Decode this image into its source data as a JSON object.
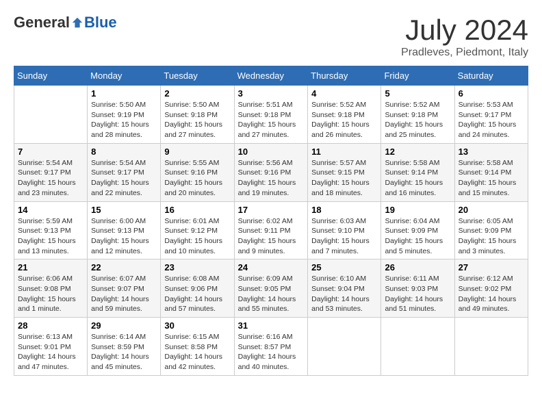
{
  "header": {
    "logo_general": "General",
    "logo_blue": "Blue",
    "month_title": "July 2024",
    "location": "Pradleves, Piedmont, Italy"
  },
  "weekdays": [
    "Sunday",
    "Monday",
    "Tuesday",
    "Wednesday",
    "Thursday",
    "Friday",
    "Saturday"
  ],
  "weeks": [
    [
      {
        "day": "",
        "sunrise": "",
        "sunset": "",
        "daylight": ""
      },
      {
        "day": "1",
        "sunrise": "Sunrise: 5:50 AM",
        "sunset": "Sunset: 9:19 PM",
        "daylight": "Daylight: 15 hours and 28 minutes."
      },
      {
        "day": "2",
        "sunrise": "Sunrise: 5:50 AM",
        "sunset": "Sunset: 9:18 PM",
        "daylight": "Daylight: 15 hours and 27 minutes."
      },
      {
        "day": "3",
        "sunrise": "Sunrise: 5:51 AM",
        "sunset": "Sunset: 9:18 PM",
        "daylight": "Daylight: 15 hours and 27 minutes."
      },
      {
        "day": "4",
        "sunrise": "Sunrise: 5:52 AM",
        "sunset": "Sunset: 9:18 PM",
        "daylight": "Daylight: 15 hours and 26 minutes."
      },
      {
        "day": "5",
        "sunrise": "Sunrise: 5:52 AM",
        "sunset": "Sunset: 9:18 PM",
        "daylight": "Daylight: 15 hours and 25 minutes."
      },
      {
        "day": "6",
        "sunrise": "Sunrise: 5:53 AM",
        "sunset": "Sunset: 9:17 PM",
        "daylight": "Daylight: 15 hours and 24 minutes."
      }
    ],
    [
      {
        "day": "7",
        "sunrise": "Sunrise: 5:54 AM",
        "sunset": "Sunset: 9:17 PM",
        "daylight": "Daylight: 15 hours and 23 minutes."
      },
      {
        "day": "8",
        "sunrise": "Sunrise: 5:54 AM",
        "sunset": "Sunset: 9:17 PM",
        "daylight": "Daylight: 15 hours and 22 minutes."
      },
      {
        "day": "9",
        "sunrise": "Sunrise: 5:55 AM",
        "sunset": "Sunset: 9:16 PM",
        "daylight": "Daylight: 15 hours and 20 minutes."
      },
      {
        "day": "10",
        "sunrise": "Sunrise: 5:56 AM",
        "sunset": "Sunset: 9:16 PM",
        "daylight": "Daylight: 15 hours and 19 minutes."
      },
      {
        "day": "11",
        "sunrise": "Sunrise: 5:57 AM",
        "sunset": "Sunset: 9:15 PM",
        "daylight": "Daylight: 15 hours and 18 minutes."
      },
      {
        "day": "12",
        "sunrise": "Sunrise: 5:58 AM",
        "sunset": "Sunset: 9:14 PM",
        "daylight": "Daylight: 15 hours and 16 minutes."
      },
      {
        "day": "13",
        "sunrise": "Sunrise: 5:58 AM",
        "sunset": "Sunset: 9:14 PM",
        "daylight": "Daylight: 15 hours and 15 minutes."
      }
    ],
    [
      {
        "day": "14",
        "sunrise": "Sunrise: 5:59 AM",
        "sunset": "Sunset: 9:13 PM",
        "daylight": "Daylight: 15 hours and 13 minutes."
      },
      {
        "day": "15",
        "sunrise": "Sunrise: 6:00 AM",
        "sunset": "Sunset: 9:13 PM",
        "daylight": "Daylight: 15 hours and 12 minutes."
      },
      {
        "day": "16",
        "sunrise": "Sunrise: 6:01 AM",
        "sunset": "Sunset: 9:12 PM",
        "daylight": "Daylight: 15 hours and 10 minutes."
      },
      {
        "day": "17",
        "sunrise": "Sunrise: 6:02 AM",
        "sunset": "Sunset: 9:11 PM",
        "daylight": "Daylight: 15 hours and 9 minutes."
      },
      {
        "day": "18",
        "sunrise": "Sunrise: 6:03 AM",
        "sunset": "Sunset: 9:10 PM",
        "daylight": "Daylight: 15 hours and 7 minutes."
      },
      {
        "day": "19",
        "sunrise": "Sunrise: 6:04 AM",
        "sunset": "Sunset: 9:09 PM",
        "daylight": "Daylight: 15 hours and 5 minutes."
      },
      {
        "day": "20",
        "sunrise": "Sunrise: 6:05 AM",
        "sunset": "Sunset: 9:09 PM",
        "daylight": "Daylight: 15 hours and 3 minutes."
      }
    ],
    [
      {
        "day": "21",
        "sunrise": "Sunrise: 6:06 AM",
        "sunset": "Sunset: 9:08 PM",
        "daylight": "Daylight: 15 hours and 1 minute."
      },
      {
        "day": "22",
        "sunrise": "Sunrise: 6:07 AM",
        "sunset": "Sunset: 9:07 PM",
        "daylight": "Daylight: 14 hours and 59 minutes."
      },
      {
        "day": "23",
        "sunrise": "Sunrise: 6:08 AM",
        "sunset": "Sunset: 9:06 PM",
        "daylight": "Daylight: 14 hours and 57 minutes."
      },
      {
        "day": "24",
        "sunrise": "Sunrise: 6:09 AM",
        "sunset": "Sunset: 9:05 PM",
        "daylight": "Daylight: 14 hours and 55 minutes."
      },
      {
        "day": "25",
        "sunrise": "Sunrise: 6:10 AM",
        "sunset": "Sunset: 9:04 PM",
        "daylight": "Daylight: 14 hours and 53 minutes."
      },
      {
        "day": "26",
        "sunrise": "Sunrise: 6:11 AM",
        "sunset": "Sunset: 9:03 PM",
        "daylight": "Daylight: 14 hours and 51 minutes."
      },
      {
        "day": "27",
        "sunrise": "Sunrise: 6:12 AM",
        "sunset": "Sunset: 9:02 PM",
        "daylight": "Daylight: 14 hours and 49 minutes."
      }
    ],
    [
      {
        "day": "28",
        "sunrise": "Sunrise: 6:13 AM",
        "sunset": "Sunset: 9:01 PM",
        "daylight": "Daylight: 14 hours and 47 minutes."
      },
      {
        "day": "29",
        "sunrise": "Sunrise: 6:14 AM",
        "sunset": "Sunset: 8:59 PM",
        "daylight": "Daylight: 14 hours and 45 minutes."
      },
      {
        "day": "30",
        "sunrise": "Sunrise: 6:15 AM",
        "sunset": "Sunset: 8:58 PM",
        "daylight": "Daylight: 14 hours and 42 minutes."
      },
      {
        "day": "31",
        "sunrise": "Sunrise: 6:16 AM",
        "sunset": "Sunset: 8:57 PM",
        "daylight": "Daylight: 14 hours and 40 minutes."
      },
      {
        "day": "",
        "sunrise": "",
        "sunset": "",
        "daylight": ""
      },
      {
        "day": "",
        "sunrise": "",
        "sunset": "",
        "daylight": ""
      },
      {
        "day": "",
        "sunrise": "",
        "sunset": "",
        "daylight": ""
      }
    ]
  ]
}
